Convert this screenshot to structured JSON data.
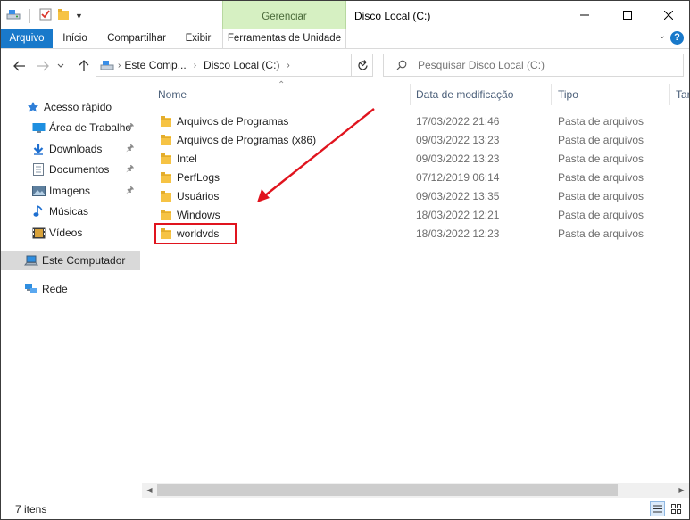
{
  "window": {
    "title": "Disco Local (C:)",
    "context_group": "Gerenciar"
  },
  "ribbon": {
    "tabs": [
      {
        "label": "Arquivo"
      },
      {
        "label": "Início"
      },
      {
        "label": "Compartilhar"
      },
      {
        "label": "Exibir"
      },
      {
        "label": "Ferramentas de Unidade"
      }
    ],
    "help": "?"
  },
  "address": {
    "crumbs": [
      "Este Comp...",
      "Disco Local (C:)"
    ]
  },
  "search": {
    "placeholder": "Pesquisar Disco Local (C:)"
  },
  "navpane": {
    "quick_access": "Acesso rápido",
    "items": [
      {
        "label": "Área de Trabalho",
        "icon": "desktop-icon",
        "pinned": true
      },
      {
        "label": "Downloads",
        "icon": "download-icon",
        "pinned": true
      },
      {
        "label": "Documentos",
        "icon": "document-icon",
        "pinned": true
      },
      {
        "label": "Imagens",
        "icon": "pictures-icon",
        "pinned": true
      },
      {
        "label": "Músicas",
        "icon": "music-icon",
        "pinned": false
      },
      {
        "label": "Vídeos",
        "icon": "video-icon",
        "pinned": false
      }
    ],
    "this_pc": "Este Computador",
    "network": "Rede"
  },
  "columns": {
    "name": "Nome",
    "date": "Data de modificação",
    "type": "Tipo",
    "size": "Tan"
  },
  "files": [
    {
      "name": "Arquivos de Programas",
      "date": "17/03/2022 21:46",
      "type": "Pasta de arquivos"
    },
    {
      "name": "Arquivos de Programas (x86)",
      "date": "09/03/2022 13:23",
      "type": "Pasta de arquivos"
    },
    {
      "name": "Intel",
      "date": "09/03/2022 13:23",
      "type": "Pasta de arquivos"
    },
    {
      "name": "PerfLogs",
      "date": "07/12/2019 06:14",
      "type": "Pasta de arquivos"
    },
    {
      "name": "Usuários",
      "date": "09/03/2022 13:35",
      "type": "Pasta de arquivos"
    },
    {
      "name": "Windows",
      "date": "18/03/2022 12:21",
      "type": "Pasta de arquivos"
    },
    {
      "name": "worldvds",
      "date": "18/03/2022 12:23",
      "type": "Pasta de arquivos"
    }
  ],
  "status": {
    "count": "7 itens"
  },
  "colors": {
    "accent": "#1979ca",
    "context_tab": "#d6f0c2",
    "annotation": "#e0141e",
    "folder": "#f6c344"
  }
}
